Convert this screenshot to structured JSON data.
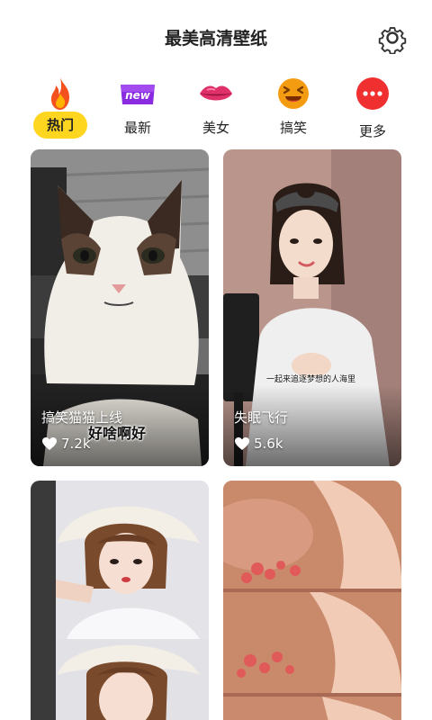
{
  "header": {
    "title": "最美高清壁纸",
    "settings_icon": "gear-icon"
  },
  "categories": [
    {
      "label": "热门",
      "icon": "flame-icon",
      "active": true
    },
    {
      "label": "最新",
      "icon": "new-badge-icon",
      "badge_text": "new"
    },
    {
      "label": "美女",
      "icon": "lips-icon"
    },
    {
      "label": "搞笑",
      "icon": "laughing-face-icon"
    },
    {
      "label": "更多",
      "icon": "more-dots-icon"
    }
  ],
  "cards": [
    {
      "caption": "搞笑猫猫上线",
      "likes": "7.2k",
      "subtitle": "好啥啊好"
    },
    {
      "caption": "失眠飞行",
      "likes": "5.6k",
      "subtitle": "一起来追逐梦想的人海里"
    },
    {
      "caption": "",
      "likes": ""
    },
    {
      "caption": "",
      "likes": ""
    }
  ],
  "colors": {
    "active_pill": "#ffd61f",
    "accent_red": "#f03030",
    "new_purple": "#8a2be2"
  }
}
